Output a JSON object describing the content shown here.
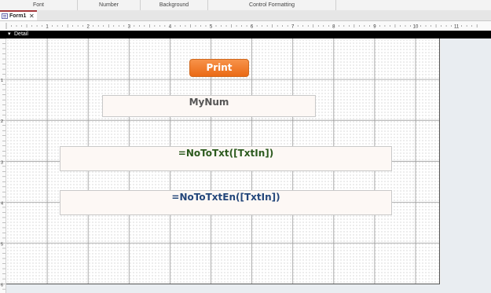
{
  "ribbon": {
    "groups": [
      "Font",
      "Number",
      "Background",
      "Control Formatting"
    ]
  },
  "tabs": {
    "active": "Form1"
  },
  "ruler": {
    "labels": [
      "1",
      "2",
      "3",
      "4",
      "5",
      "6",
      "7",
      "8",
      "9",
      "10",
      "11"
    ]
  },
  "vruler": {
    "labels": [
      "1",
      "2",
      "3",
      "4",
      "5",
      "6"
    ]
  },
  "section": {
    "label": "Detail"
  },
  "controls": {
    "print_label": "Print",
    "mynum": "MyNum",
    "txt_formula": "=NoToTxt([TxtIn])",
    "en_formula": "=NoToTxtEn([TxtIn])"
  },
  "colors": {
    "button_orange": "#ef7b2c",
    "tab_accent": "#a4373a",
    "formula_green": "#2c5a1e",
    "formula_blue": "#23467a"
  }
}
